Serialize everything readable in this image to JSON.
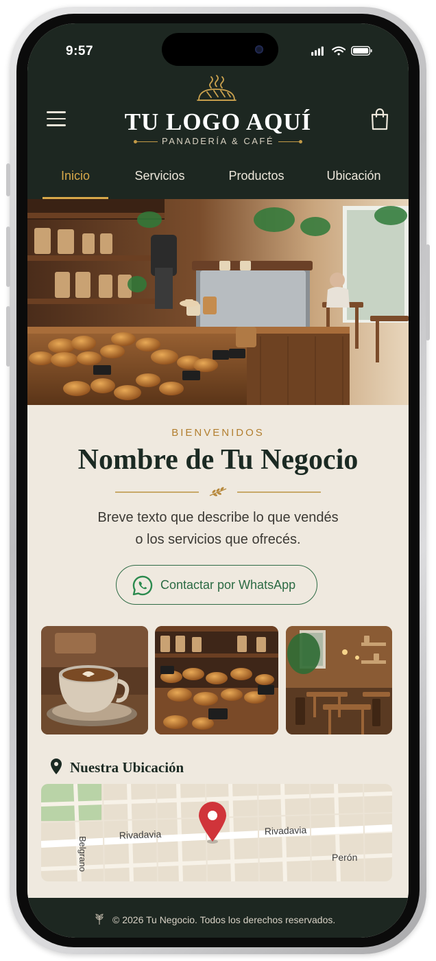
{
  "status_bar": {
    "time": "9:57"
  },
  "brand": {
    "logo_text": "TU LOGO AQUÍ",
    "tagline": "PANADERÍA & CAFÉ"
  },
  "nav": {
    "items": [
      {
        "label": "Inicio",
        "active": true
      },
      {
        "label": "Servicios",
        "active": false
      },
      {
        "label": "Productos",
        "active": false
      },
      {
        "label": "Ubicación",
        "active": false
      }
    ]
  },
  "welcome": {
    "eyebrow": "BIENVENIDOS",
    "title": "Nombre de Tu Negocio",
    "description_line1": "Breve texto que describe lo que vendés",
    "description_line2": "o los servicios que ofrecés."
  },
  "whatsapp_button": {
    "label": "Contactar por WhatsApp"
  },
  "location": {
    "title": "Nuestra Ubicación",
    "map_labels": {
      "street_1": "Rivadavia",
      "street_2": "Rivadavia",
      "street_3": "Belgrano",
      "street_4": "Perón"
    }
  },
  "footer": {
    "text": "© 2026 Tu Negocio. Todos los derechos reservados."
  },
  "colors": {
    "header_bg": "#1d2721",
    "accent_gold": "#d8a84a",
    "content_bg": "#efe9df",
    "whatsapp_green": "#2b6a43",
    "pin_red": "#d0343a"
  }
}
